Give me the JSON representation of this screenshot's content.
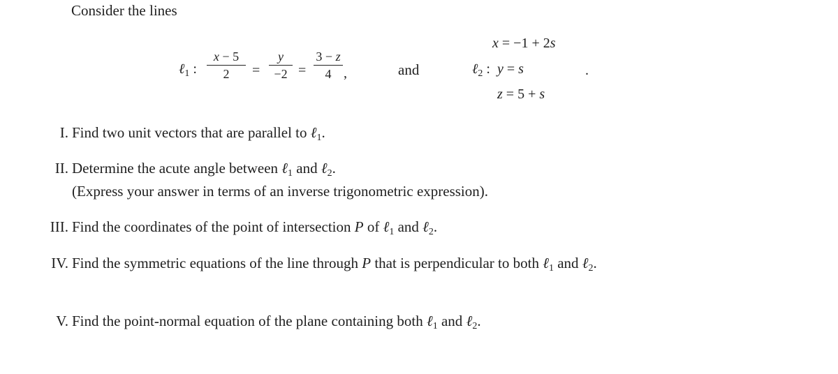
{
  "intro": "Consider the lines",
  "line1": {
    "label": "ℓ",
    "sub": "1",
    "colon": ":",
    "frac1": {
      "num_var": "x",
      "num_rest": " − 5",
      "den": "2"
    },
    "eq1": "=",
    "frac2": {
      "num_var": "y",
      "den": "−2"
    },
    "eq2": "=",
    "frac3": {
      "num_rest": "3 − ",
      "num_var": "z",
      "den": "4"
    },
    "comma": ","
  },
  "connector": "and",
  "line2": {
    "label": "ℓ",
    "sub": "2",
    "colon": ":",
    "eq_x": {
      "var": "x",
      "rhs": " = −1 + 2",
      "param": "s"
    },
    "eq_y": {
      "var": "y",
      "rhs": " = ",
      "param": "s"
    },
    "eq_z": {
      "var": "z",
      "rhs": " = 5 + ",
      "param": "s"
    },
    "period": "."
  },
  "questions": [
    {
      "num": "I.",
      "text": "Find two unit vectors that are parallel to ",
      "refs": [
        "1"
      ],
      "tail": "."
    },
    {
      "num": "II.",
      "text": "Determine the acute angle between ",
      "refs": [
        "1",
        "2"
      ],
      "mid": " and ",
      "tail": ".",
      "note": "(Express your answer in terms of an inverse trigonometric expression)."
    },
    {
      "num": "III.",
      "text": "Find the coordinates of the point of intersection ",
      "point": "P",
      "text2": " of ",
      "refs": [
        "1",
        "2"
      ],
      "mid": " and ",
      "tail": "."
    },
    {
      "num": "IV.",
      "text": "Find the symmetric equations of the line through ",
      "point": "P",
      "text2": " that is perpendicular to both ",
      "refs": [
        "1",
        "2"
      ],
      "mid": " and ",
      "tail": "."
    },
    {
      "num": "V.",
      "text": "Find the point-normal equation of the plane containing both ",
      "refs": [
        "1",
        "2"
      ],
      "mid": " and ",
      "tail": "."
    }
  ]
}
